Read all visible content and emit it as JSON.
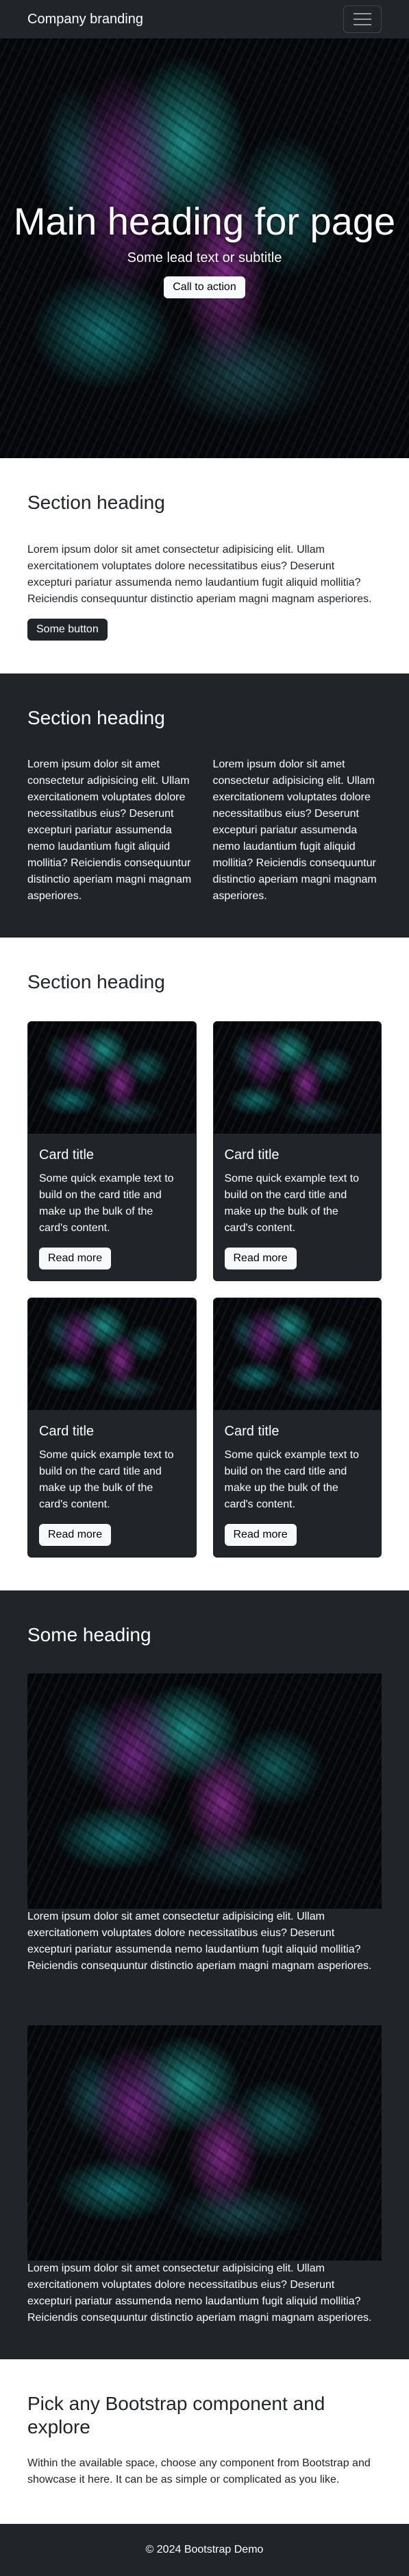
{
  "navbar": {
    "brand": "Company branding",
    "toggle_icon": "hamburger-menu-icon"
  },
  "hero": {
    "title": "Main heading for page",
    "subtitle": "Some lead text or subtitle",
    "cta_label": "Call to action"
  },
  "section1": {
    "heading": "Section heading",
    "text": "Lorem ipsum dolor sit amet consectetur adipisicing elit. Ullam exercitationem voluptates dolore necessitatibus eius? Deserunt excepturi pariatur assumenda nemo laudantium fugit aliquid mollitia? Reiciendis consequuntur distinctio aperiam magni magnam asperiores.",
    "button_label": "Some button"
  },
  "section2": {
    "heading": "Section heading",
    "col1": "Lorem ipsum dolor sit amet consectetur adipisicing elit. Ullam exercitationem voluptates dolore necessitatibus eius? Deserunt excepturi pariatur assumenda nemo laudantium fugit aliquid mollitia? Reiciendis consequuntur distinctio aperiam magni magnam asperiores.",
    "col2": "Lorem ipsum dolor sit amet consectetur adipisicing elit. Ullam exercitationem voluptates dolore necessitatibus eius? Deserunt excepturi pariatur assumenda nemo laudantium fugit aliquid mollitia? Reiciendis consequuntur distinctio aperiam magni magnam asperiores."
  },
  "section3": {
    "heading": "Section heading",
    "cards": [
      {
        "title": "Card title",
        "text": "Some quick example text to build on the card title and make up the bulk of the card's content.",
        "button": "Read more"
      },
      {
        "title": "Card title",
        "text": "Some quick example text to build on the card title and make up the bulk of the card's content.",
        "button": "Read more"
      },
      {
        "title": "Card title",
        "text": "Some quick example text to build on the card title and make up the bulk of the card's content.",
        "button": "Read more"
      },
      {
        "title": "Card title",
        "text": "Some quick example text to build on the card title and make up the bulk of the card's content.",
        "button": "Read more"
      }
    ]
  },
  "section4": {
    "heading": "Some heading",
    "blocks": [
      {
        "text": "Lorem ipsum dolor sit amet consectetur adipisicing elit. Ullam exercitationem voluptates dolore necessitatibus eius? Deserunt excepturi pariatur assumenda nemo laudantium fugit aliquid mollitia? Reiciendis consequuntur distinctio aperiam magni magnam asperiores."
      },
      {
        "text": "Lorem ipsum dolor sit amet consectetur adipisicing elit. Ullam exercitationem voluptates dolore necessitatibus eius? Deserunt excepturi pariatur assumenda nemo laudantium fugit aliquid mollitia? Reiciendis consequuntur distinctio aperiam magni magnam asperiores."
      }
    ]
  },
  "section5": {
    "heading": "Pick any Bootstrap component and explore",
    "text": "Within the available space, choose any component from Bootstrap and showcase it here. It can be as simple or complicated as you like."
  },
  "footer": {
    "text": "© 2024 Bootstrap Demo"
  },
  "colors": {
    "dark": "#212529",
    "light": "#f8f9fa",
    "accent_teal": "#1eaaa0",
    "accent_purple": "#a032aa"
  }
}
